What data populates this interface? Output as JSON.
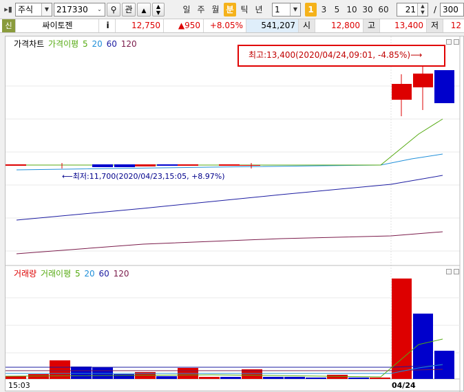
{
  "toolbar": {
    "market": "주식",
    "code": "217330",
    "gwan": "관",
    "periods": [
      "일",
      "주",
      "월",
      "분",
      "틱",
      "년"
    ],
    "active_period": "분",
    "interval": "1",
    "intervals": [
      "1",
      "3",
      "5",
      "10",
      "30",
      "60"
    ],
    "active_interval": "1",
    "count": "21",
    "slash": "/",
    "total": "300"
  },
  "infobar": {
    "badge": "신",
    "name": "싸이토젠",
    "info": "i",
    "price": "12,750",
    "change": "▲950",
    "change_pct": "+8.05%",
    "volume": "541,207",
    "open_label": "시",
    "open": "12,800",
    "high_label": "고",
    "high": "13,400",
    "low_label": "저",
    "low": "12"
  },
  "price_panel": {
    "legend": {
      "title": "가격차트",
      "ma_label": "가격이평",
      "ma5": "5",
      "ma20": "20",
      "ma60": "60",
      "ma120": "120"
    },
    "high_annotation": "최고:13,400(2020/04/24,09:01, -4.85%)⟶",
    "low_annotation": "⟵최저:11,700(2020/04/23,15:05, +8.97%)"
  },
  "volume_panel": {
    "legend": {
      "title": "거래량",
      "ma_label": "거래이평",
      "ma5": "5",
      "ma20": "20",
      "ma60": "60",
      "ma120": "120"
    }
  },
  "xaxis": {
    "left_label": "15:03",
    "date_label": "04/24"
  },
  "colors": {
    "up": "#dd0000",
    "down": "#0000cc",
    "ma5": "#55aa11",
    "ma20": "#1f8fd9",
    "ma60": "#1a1aa0",
    "ma120": "#7a1a4a",
    "accent": "#f5b21a"
  }
}
